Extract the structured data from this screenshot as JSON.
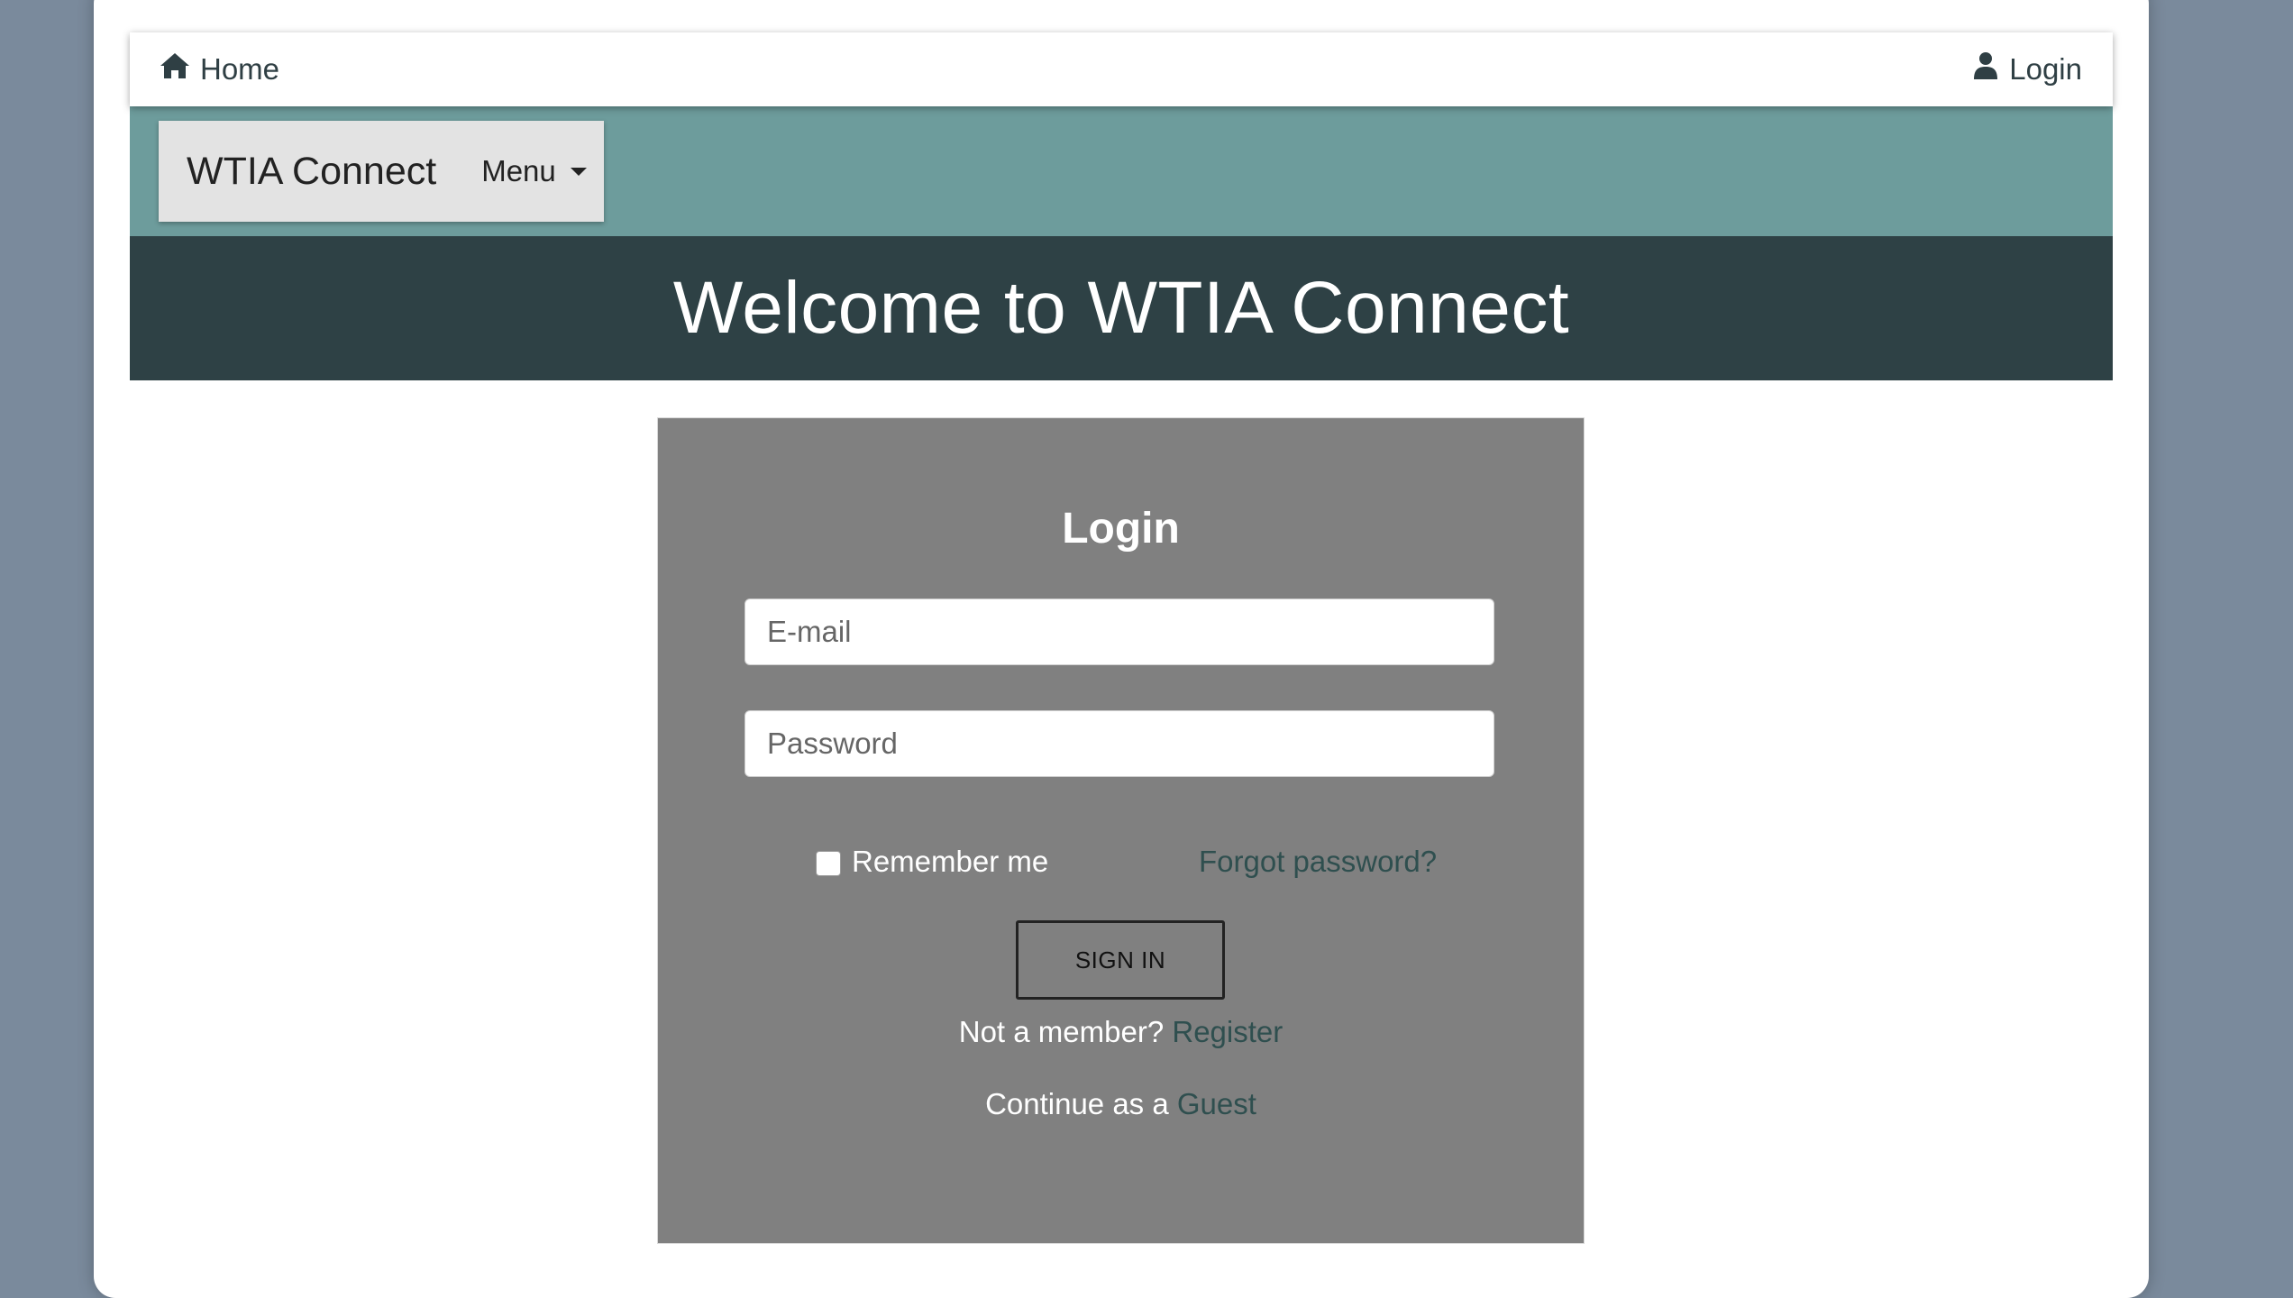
{
  "topbar": {
    "home_label": "Home",
    "login_label": "Login",
    "icon_color": "#2f3f44"
  },
  "navbar": {
    "brand": "WTIA Connect",
    "menu_label": "Menu",
    "band_color": "#6d9c9c"
  },
  "hero": {
    "title": "Welcome to WTIA Connect",
    "bg_color": "#2e4145"
  },
  "login": {
    "title": "Login",
    "email_placeholder": "E-mail",
    "password_placeholder": "Password",
    "remember_label": "Remember me",
    "remember_checked": false,
    "forgot_label": "Forgot password?",
    "signin_label": "SIGN IN",
    "register_prefix": "Not a member?",
    "register_link": "Register",
    "guest_prefix": "Continue as a",
    "guest_link": "Guest",
    "panel_color": "#808080",
    "link_color": "#2f4f4f"
  },
  "icons": {
    "home": "home-icon",
    "user": "user-icon",
    "caret": "caret-down-icon",
    "checkbox": "checkbox-icon"
  }
}
